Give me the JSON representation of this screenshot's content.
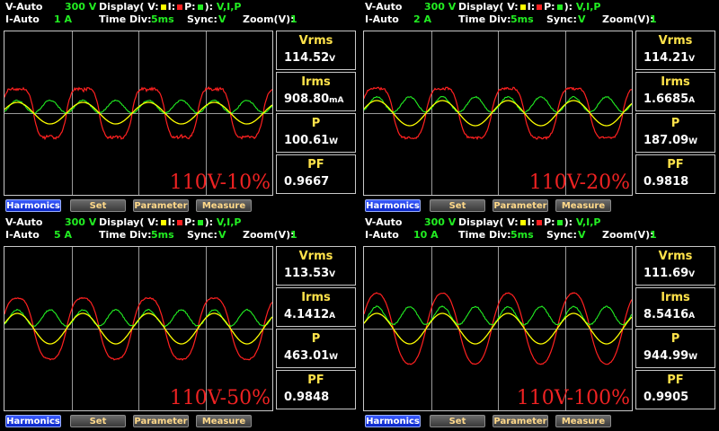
{
  "colors": {
    "voltage": "#ffff00",
    "current": "#ff2020",
    "power": "#22ee22"
  },
  "header": {
    "v_mode": "V-Auto",
    "i_mode": "I-Auto",
    "display_prefix": "Display( V:",
    "display_i": "I:",
    "display_p": "P:",
    "display_suffix": "):",
    "display_channels": "V,I,P",
    "time_div_label": "Time  Div:",
    "sync_label": "Sync:",
    "zoom_label": "Zoom(V):"
  },
  "measure_labels": {
    "vrms": "Vrms",
    "irms": "Irms",
    "p": "P",
    "pf": "PF"
  },
  "buttons": [
    "Harmonics",
    "Set",
    "Parameter",
    "Measure"
  ],
  "panels": [
    {
      "v_range": "300 V",
      "i_range": "1 A",
      "time_div": "5ms",
      "sync": "V",
      "zoom": "1",
      "vrms": "114.52",
      "vrms_unit": "V",
      "irms": "908.80",
      "irms_unit": "mA",
      "p": "100.61",
      "p_unit": "W",
      "pf": "0.9667",
      "watermark": "110V-10%"
    },
    {
      "v_range": "300 V",
      "i_range": "2 A",
      "time_div": "5ms",
      "sync": "V",
      "zoom": "1",
      "vrms": "114.21",
      "vrms_unit": "V",
      "irms": "1.6685",
      "irms_unit": "A",
      "p": "187.09",
      "p_unit": "W",
      "pf": "0.9818",
      "watermark": "110V-20%"
    },
    {
      "v_range": "300 V",
      "i_range": "5 A",
      "time_div": "5ms",
      "sync": "V",
      "zoom": "1",
      "vrms": "113.53",
      "vrms_unit": "V",
      "irms": "4.1412",
      "irms_unit": "A",
      "p": "463.01",
      "p_unit": "W",
      "pf": "0.9848",
      "watermark": "110V-50%"
    },
    {
      "v_range": "300 V",
      "i_range": "10 A",
      "time_div": "5ms",
      "sync": "V",
      "zoom": "1",
      "vrms": "111.69",
      "vrms_unit": "V",
      "irms": "8.5416",
      "irms_unit": "A",
      "p": "944.99",
      "p_unit": "W",
      "pf": "0.9905",
      "watermark": "110V-100%"
    }
  ]
}
